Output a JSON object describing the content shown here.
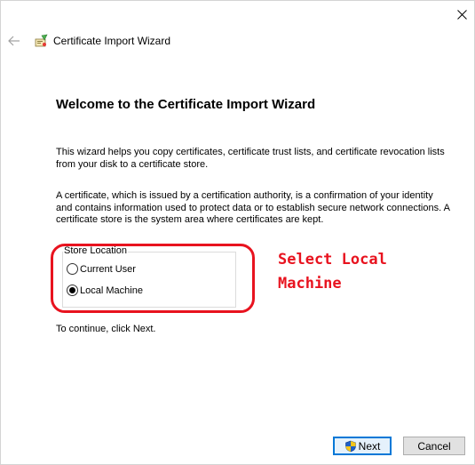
{
  "window": {
    "title": "Certificate Import Wizard"
  },
  "icons": {
    "close": "close-icon",
    "back": "back-arrow-icon",
    "wizard": "certificate-wizard-icon",
    "shield": "uac-shield-icon"
  },
  "main": {
    "heading": "Welcome to the Certificate Import Wizard",
    "paragraph1": "This wizard helps you copy certificates, certificate trust lists, and certificate revocation lists from your disk to a certificate store.",
    "paragraph2": "A certificate, which is issued by a certification authority, is a confirmation of your identity and contains information used to protect data or to establish secure network connections. A certificate store is the system area where certificates are kept.",
    "store_location": {
      "label": "Store Location",
      "options": [
        {
          "label": "Current User",
          "selected": false
        },
        {
          "label": "Local Machine",
          "selected": true
        }
      ]
    },
    "continue_text": "To continue, click Next."
  },
  "annotation": {
    "text": "Select Local Machine",
    "color": "#e8131f"
  },
  "buttons": {
    "next": "Next",
    "cancel": "Cancel"
  },
  "colors": {
    "accent": "#0078d7",
    "annotation": "#e8131f"
  }
}
